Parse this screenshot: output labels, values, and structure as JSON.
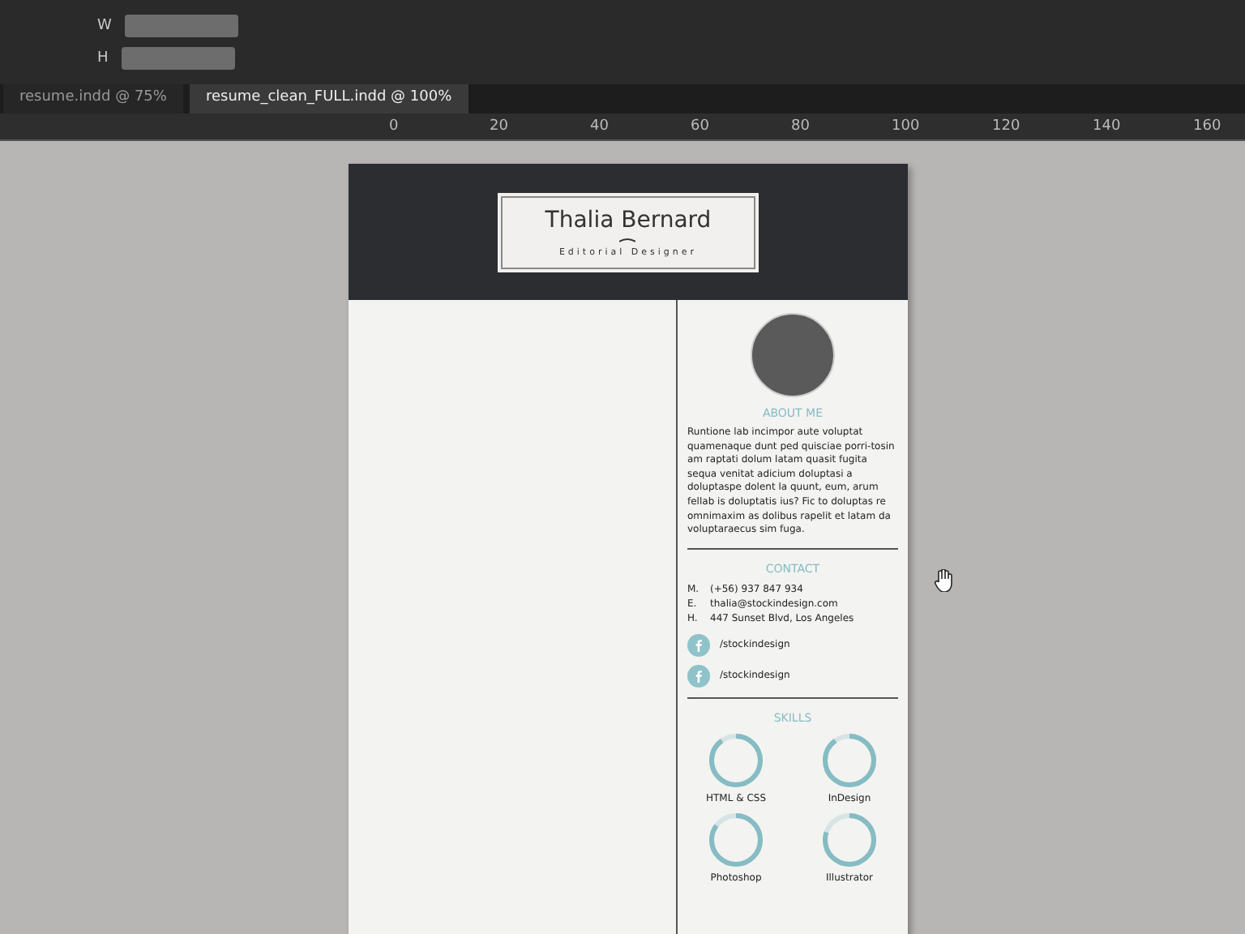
{
  "toolbar": {
    "fields": [
      {
        "label": "W"
      },
      {
        "label": "H"
      }
    ]
  },
  "tabs": [
    {
      "label": "resume.indd @ 75%",
      "selected": false
    },
    {
      "label": "resume_clean_FULL.indd @ 100%",
      "selected": true
    }
  ],
  "ruler": [
    "0",
    "20",
    "40",
    "60",
    "80",
    "100",
    "120",
    "140",
    "160"
  ],
  "resume": {
    "name": "Thalia Bernard",
    "role": "Editorial Designer",
    "about": {
      "title": "ABOUT ME",
      "text": "Runtione lab incimpor aute voluptat quamenaque dunt ped quisciae porri-tosin am raptati dolum latam quasit fugita sequa venitat adicium doluptasi a doluptaspe dolent la quunt, eum, arum fellab is doluptatis ius? Fic to doluptas re omnimaxim as dolibus rapelit et latam da voluptaraecus sim fuga."
    },
    "contact": {
      "title": "CONTACT",
      "lines": [
        {
          "key": "M.",
          "value": "(+56) 937 847 934"
        },
        {
          "key": "E.",
          "value": "thalia@stockindesign.com"
        },
        {
          "key": "H.",
          "value": "447 Sunset Blvd, Los Angeles"
        }
      ]
    },
    "social": [
      {
        "handle": "/stockindesign"
      },
      {
        "handle": "/stockindesign"
      }
    ],
    "skills": {
      "title": "SKILLS",
      "items": [
        {
          "name": "HTML & CSS",
          "level": 0.9
        },
        {
          "name": "InDesign",
          "level": 0.9
        },
        {
          "name": "Photoshop",
          "level": 0.85
        },
        {
          "name": "Illustrator",
          "level": 0.8
        }
      ]
    }
  }
}
